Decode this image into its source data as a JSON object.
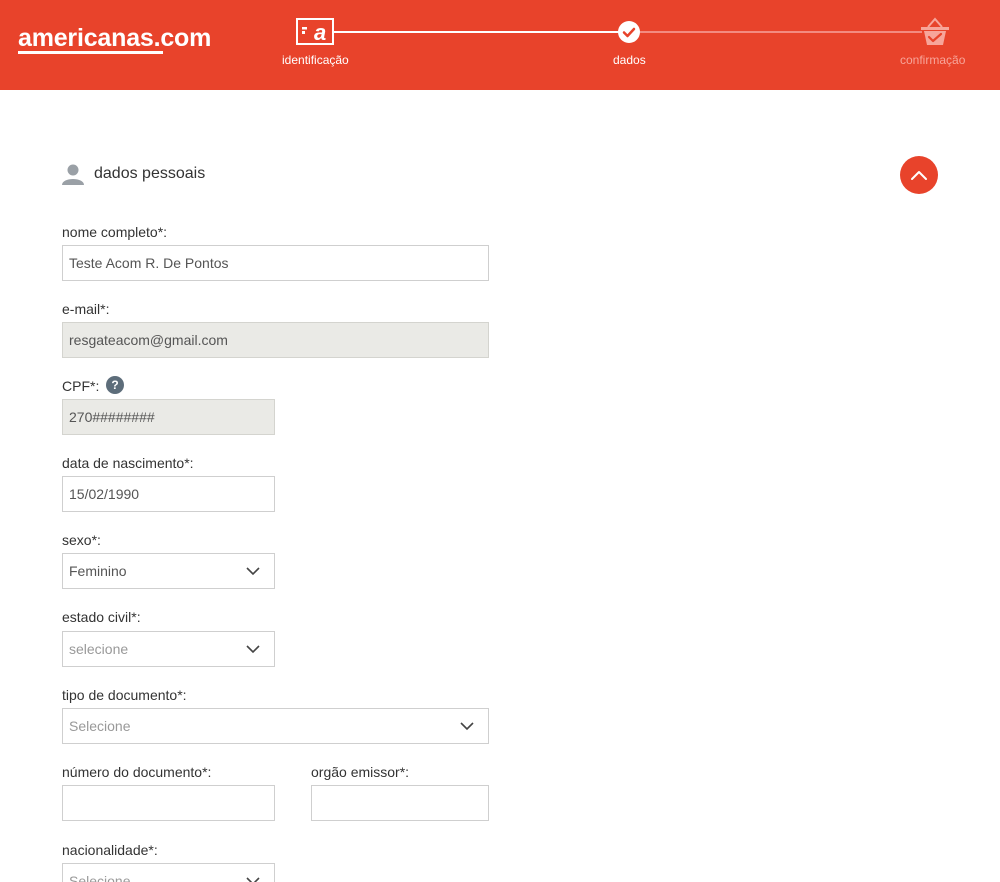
{
  "header": {
    "logo": "americanas.com",
    "steps": [
      {
        "label": "identificação",
        "state": "done"
      },
      {
        "label": "dados",
        "state": "current"
      },
      {
        "label": "confirmação",
        "state": "pending"
      }
    ],
    "colors": {
      "brand": "#e8432b",
      "pending": "#f7a59a"
    }
  },
  "section": {
    "title": "dados pessoais",
    "icon": "user-icon",
    "toggle_icon": "chevron-up-icon"
  },
  "form": {
    "full_name": {
      "label": "nome completo*:",
      "value": "Teste Acom R. De Pontos"
    },
    "email": {
      "label": "e-mail*:",
      "value": "resgateacom@gmail.com"
    },
    "cpf": {
      "label": "CPF*:",
      "value": "270########",
      "help": "?"
    },
    "birth_date": {
      "label": "data de nascimento*:",
      "value": "15/02/1990"
    },
    "sex": {
      "label": "sexo*:",
      "value": "Feminino"
    },
    "marital_status": {
      "label": "estado civil*:",
      "placeholder": "selecione"
    },
    "document_type": {
      "label": "tipo de documento*:",
      "placeholder": "Selecione"
    },
    "document_number": {
      "label": "número do documento*:",
      "value": ""
    },
    "issuing_body": {
      "label": "orgão emissor*:",
      "value": ""
    },
    "nationality": {
      "label": "nacionalidade*:",
      "placeholder": "Selecione"
    }
  }
}
